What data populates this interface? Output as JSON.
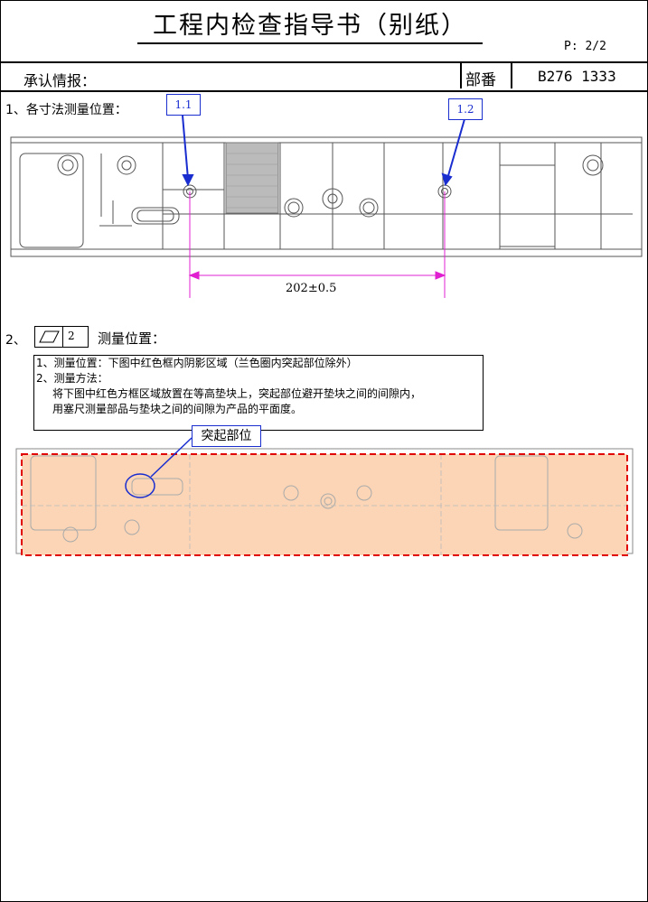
{
  "header": {
    "title": "工程内检查指导书（别纸）",
    "page": "P: 2/2",
    "approval_label": "承认情报：",
    "part_label": "部番",
    "part_number": "B276 1333"
  },
  "section1": {
    "heading": "1、各寸法测量位置：",
    "bubbles": [
      "1.1",
      "1.2"
    ],
    "dimension": "202±0.5"
  },
  "section2": {
    "number": "2、",
    "tolerance_value": "2",
    "heading": "测量位置：",
    "notes": [
      "1、测量位置：下图中红色框内阴影区域（兰色圈内突起部位除外）",
      "2、测量方法：",
      "将下图中红色方框区域放置在等高垫块上，突起部位避开垫块之间的间隙内，",
      "用塞尺测量部品与垫块之间的间隙为产品的平面度。"
    ],
    "callout": "突起部位"
  },
  "colors": {
    "bubble_blue": "#1a2ed0",
    "dimension_magenta": "#e020d0",
    "frame_red": "#e00000",
    "shade_orange": "#fbd5b5"
  }
}
